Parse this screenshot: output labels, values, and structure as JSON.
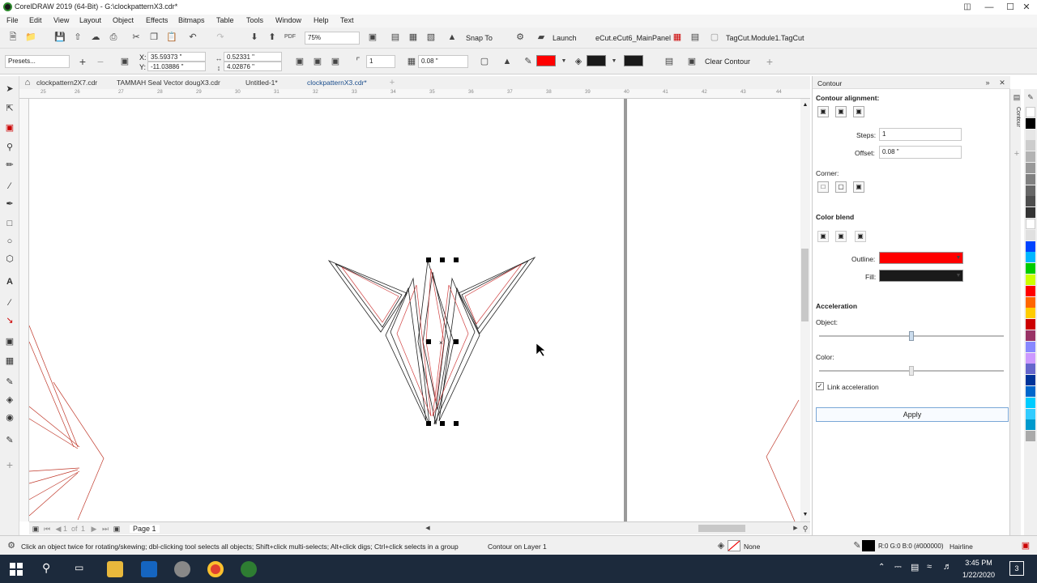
{
  "window": {
    "title": "CorelDRAW 2019 (64-Bit) - G:\\clockpatternX3.cdr*",
    "minimize": "—",
    "maximize": "☐",
    "close": "✕"
  },
  "menu": [
    "File",
    "Edit",
    "View",
    "Layout",
    "Object",
    "Effects",
    "Bitmaps",
    "Table",
    "Tools",
    "Window",
    "Help",
    "Text"
  ],
  "standard_toolbar": {
    "zoom_value": "75%",
    "snap_label": "Snap To",
    "launch_label": "Launch",
    "macro_label": "eCut.eCut6_MainPanel",
    "tagcut_label": "TagCut.Module1.TagCut"
  },
  "property_bar": {
    "presets": "Presets...",
    "x_value": "35.59373 \"",
    "y_value": "-11.03886 \"",
    "width_value": "0.52331 \"",
    "height_value": "4.02876 \"",
    "steps_value": "1",
    "offset_value": "0.08 \"",
    "clear_contour": "Clear Contour",
    "outline_color": "#ff0000",
    "fill_color": "#1a1a1a"
  },
  "doc_tabs": [
    "clockpattern2X7.cdr",
    "TAMMAH Seal Vector dougX3.cdr",
    "Untitled-1*",
    "clockpatternX3.cdr*"
  ],
  "ruler_ticks": [
    "25",
    "26",
    "27",
    "28",
    "29",
    "30",
    "31",
    "32",
    "33",
    "34",
    "35",
    "36",
    "37",
    "38",
    "39",
    "40",
    "41",
    "42",
    "43",
    "44"
  ],
  "page_nav": {
    "current": "1",
    "of_label": "of",
    "total": "1",
    "page_tab": "Page 1"
  },
  "docker": {
    "title": "Contour",
    "tab_label": "Contour",
    "alignment_heading": "Contour alignment:",
    "steps_label": "Steps:",
    "steps_value": "1",
    "offset_label": "Offset:",
    "offset_value": "0.08 \"",
    "corner_label": "Corner:",
    "color_blend_heading": "Color blend",
    "outline_label": "Outline:",
    "outline_color": "#ff0000",
    "fill_label": "Fill:",
    "fill_color": "#1a1a1a",
    "acceleration_heading": "Acceleration",
    "object_label": "Object:",
    "object_accel": 0.5,
    "color_label": "Color:",
    "color_accel": 0.5,
    "link_acceleration": "Link acceleration",
    "link_checked": true,
    "apply_label": "Apply"
  },
  "palette": [
    "#ffffff",
    "#000000",
    "#e6e6e6",
    "#cccccc",
    "#b3b3b3",
    "#999999",
    "#808080",
    "#666666",
    "#4d4d4d",
    "#333333",
    "#ffffff",
    "#e0e0e0",
    "#0044ff",
    "#00b7ff",
    "#00cc00",
    "#ccff00",
    "#ff0000",
    "#ff6600",
    "#ffcc00",
    "#cc0000",
    "#993366",
    "#8888ff",
    "#cc99ff",
    "#6666cc",
    "#003399",
    "#0066cc",
    "#00ccff",
    "#33ccff",
    "#0099cc",
    "#aaaaaa"
  ],
  "status": {
    "hint": "Click an object twice for rotating/skewing; dbl-clicking tool selects all objects; Shift+click multi-selects; Alt+click digs; Ctrl+click selects in a group",
    "selection": "Contour on Layer 1",
    "fill_none": "None",
    "color_info": "R:0 G:0 B:0 (#000000)",
    "outline_width": "Hairline"
  },
  "taskbar": {
    "time": "3:45 PM",
    "date": "1/22/2020",
    "notifications": "3"
  }
}
